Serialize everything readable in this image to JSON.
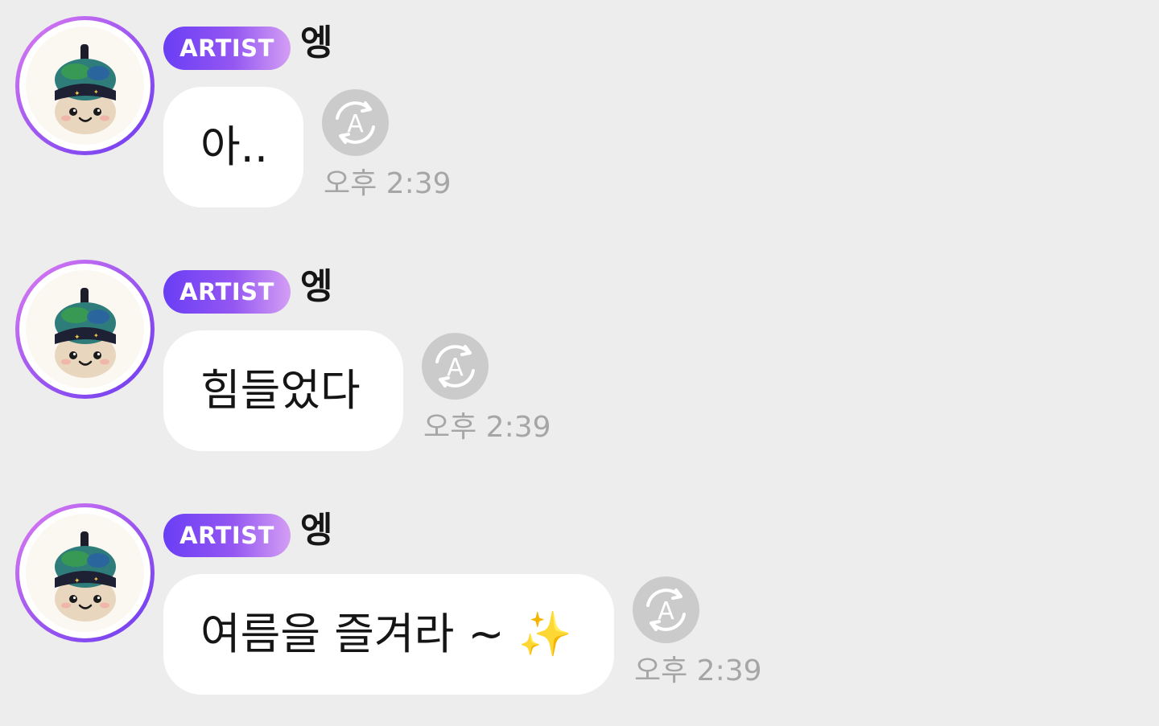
{
  "chat": {
    "messages": [
      {
        "badge": "ARTIST",
        "sender": "엥",
        "text": "아..",
        "time": "오후 2:39",
        "avatar_icon": "plush-doll-avatar",
        "translate_icon": "translate-icon"
      },
      {
        "badge": "ARTIST",
        "sender": "엥",
        "text": "힘들었다",
        "time": "오후 2:39",
        "avatar_icon": "plush-doll-avatar",
        "translate_icon": "translate-icon"
      },
      {
        "badge": "ARTIST",
        "sender": "엥",
        "text": "여름을 즐겨라 ~",
        "emoji": "✨",
        "time": "오후 2:39",
        "avatar_icon": "plush-doll-avatar",
        "translate_icon": "translate-icon"
      }
    ]
  },
  "colors": {
    "background": "#ededed",
    "bubble": "#ffffff",
    "badge_gradient": [
      "#6a3ef5",
      "#d49ef4"
    ],
    "avatar_ring_gradient": [
      "#e07cf2",
      "#6d3cf0"
    ],
    "translate_button": "#cbcbcb",
    "timestamp": "#a6a6a6"
  }
}
